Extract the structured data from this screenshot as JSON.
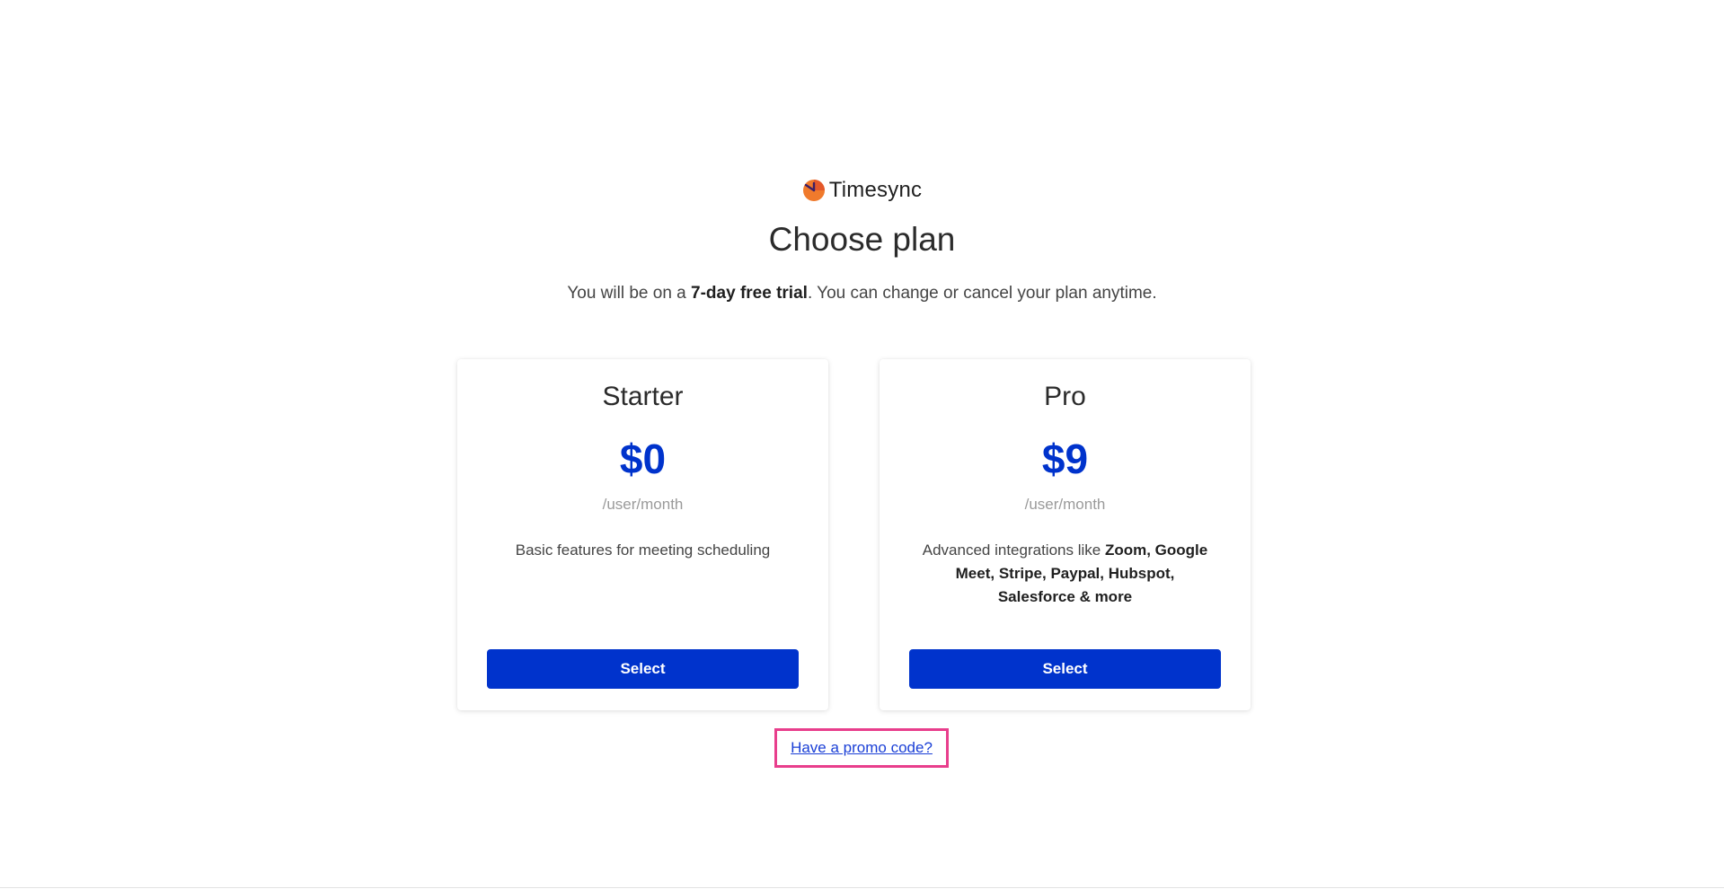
{
  "brand": {
    "name": "Timesync",
    "logo_icon": "clock-pie-icon",
    "logo_color": "#f07a2c"
  },
  "header": {
    "title": "Choose plan",
    "subtitle_prefix": "You will be on a ",
    "subtitle_bold": "7-day free trial",
    "subtitle_suffix": ". You can change or cancel your plan anytime."
  },
  "plans": [
    {
      "name": "Starter",
      "price": "$0",
      "unit": "/user/month",
      "description_plain": "Basic features for meeting scheduling",
      "description_bold": "",
      "button_label": "Select"
    },
    {
      "name": "Pro",
      "price": "$9",
      "unit": "/user/month",
      "description_plain": "Advanced integrations like ",
      "description_bold": "Zoom, Google Meet, Stripe, Paypal, Hubspot, Salesforce & more",
      "button_label": "Select"
    }
  ],
  "promo": {
    "link_text": "Have a promo code?"
  },
  "colors": {
    "accent": "#0033cc",
    "highlight_border": "#e83e8c",
    "link": "#1a3fd6"
  }
}
